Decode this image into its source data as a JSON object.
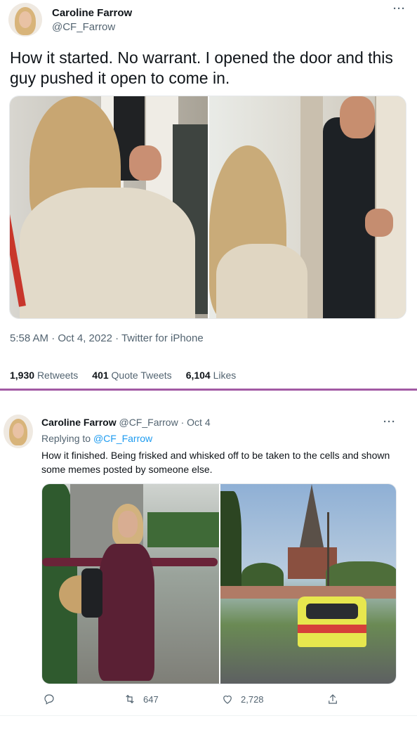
{
  "tweet1": {
    "name": "Caroline Farrow",
    "handle": "@CF_Farrow",
    "more": "···",
    "text": "How it started. No warrant. I opened the door and this guy pushed it open to come in.",
    "timestamp": "5:58 AM · Oct 4, 2022 · Twitter for iPhone",
    "stats": {
      "retweets_count": "1,930",
      "retweets_label": "Retweets",
      "quotes_count": "401",
      "quotes_label": "Quote Tweets",
      "likes_count": "6,104",
      "likes_label": "Likes"
    }
  },
  "tweet2": {
    "name": "Caroline Farrow",
    "handle": "@CF_Farrow",
    "date": "· Oct 4",
    "more": "···",
    "replying_prefix": "Replying to",
    "replying_to": "@CF_Farrow",
    "text": "How it finished. Being frisked and whisked off to be taken to the cells and shown some memes posted by someone else.",
    "actions": {
      "reply": "",
      "retweets": "647",
      "likes": "2,728"
    }
  },
  "colors": {
    "divider": "#a25aa4",
    "link": "#1d9bf0",
    "muted": "#536471"
  },
  "icons": [
    "reply-icon",
    "retweet-icon",
    "like-icon",
    "share-icon"
  ]
}
